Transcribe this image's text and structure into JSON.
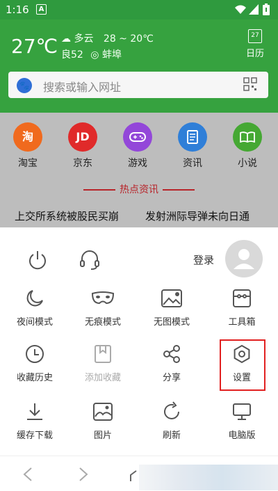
{
  "status_bar": {
    "time": "1:16",
    "app_letter": "A"
  },
  "weather": {
    "temperature": "27℃",
    "condition": "多云",
    "range": "28 ~ 20℃",
    "air_quality": "良52",
    "location": "蚌埠"
  },
  "calendar": {
    "day": "27",
    "label": "日历"
  },
  "search": {
    "placeholder": "搜索或输入网址"
  },
  "shortcuts": [
    {
      "label": "淘宝",
      "glyph": "淘",
      "color": "#f06a1e"
    },
    {
      "label": "京东",
      "glyph": "JD",
      "color": "#e02a2a"
    },
    {
      "label": "游戏",
      "glyph": "🎮",
      "color": "#9347d9"
    },
    {
      "label": "资讯",
      "glyph": "▤",
      "color": "#2f7fd8"
    },
    {
      "label": "小说",
      "glyph": "📖",
      "color": "#45a833"
    }
  ],
  "hot_news": {
    "title": "热点资讯",
    "items": [
      "上交所系统被股民买崩",
      "发射洲际导弹未向日通"
    ]
  },
  "menu": {
    "login": "登录",
    "items": [
      {
        "label": "夜间模式",
        "icon": "moon-icon"
      },
      {
        "label": "无痕模式",
        "icon": "mask-icon"
      },
      {
        "label": "无图模式",
        "icon": "no-image-icon"
      },
      {
        "label": "工具箱",
        "icon": "toolbox-icon"
      },
      {
        "label": "收藏历史",
        "icon": "clock-icon"
      },
      {
        "label": "添加收藏",
        "icon": "bookmark-add-icon"
      },
      {
        "label": "分享",
        "icon": "share-icon"
      },
      {
        "label": "设置",
        "icon": "settings-icon"
      },
      {
        "label": "缓存下载",
        "icon": "download-icon"
      },
      {
        "label": "图片",
        "icon": "image-icon"
      },
      {
        "label": "刷新",
        "icon": "refresh-icon"
      },
      {
        "label": "电脑版",
        "icon": "desktop-icon"
      }
    ]
  },
  "colors": {
    "header_green": "#36a23f",
    "hot_red": "#b8242a",
    "highlight_red": "#e12020"
  }
}
